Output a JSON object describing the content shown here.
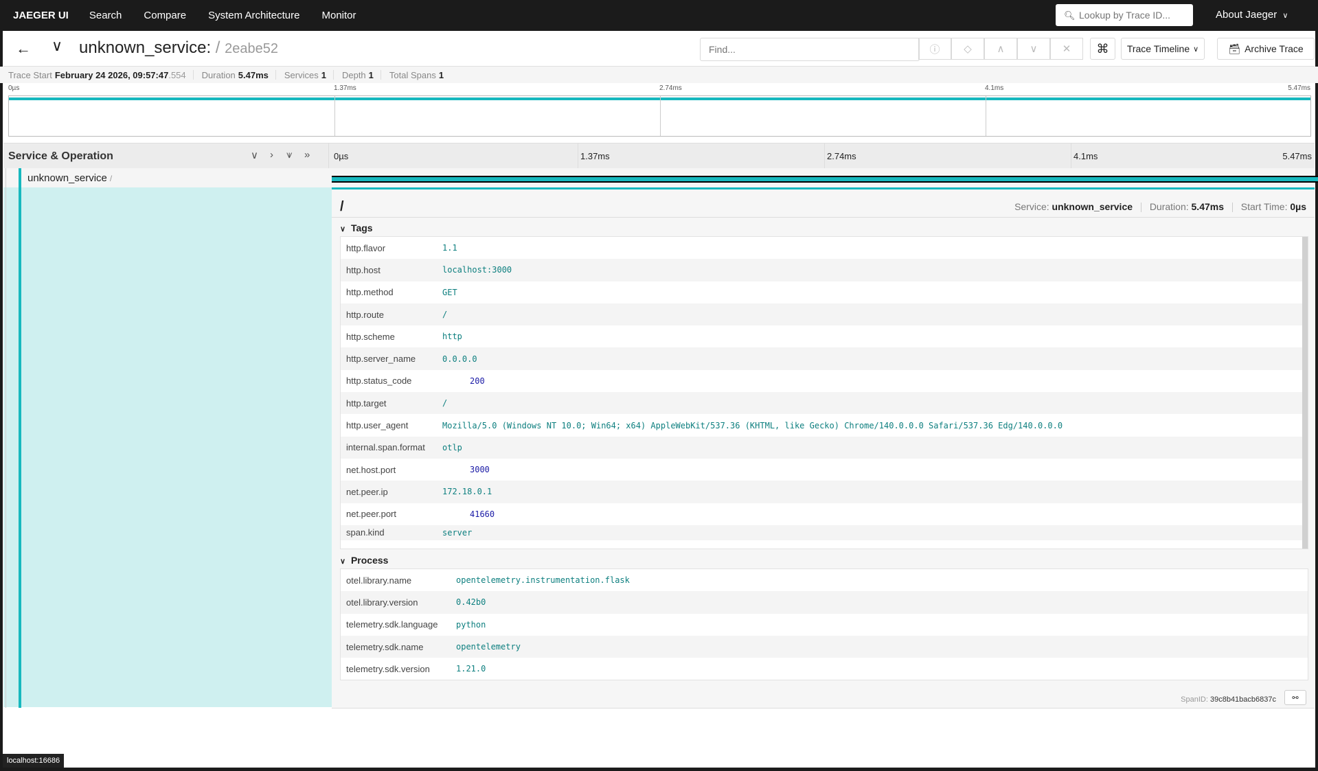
{
  "nav": {
    "brand": "JAEGER UI",
    "links": [
      "Search",
      "Compare",
      "System Architecture",
      "Monitor"
    ],
    "lookup_placeholder": "Lookup by Trace ID...",
    "about": "About Jaeger"
  },
  "header": {
    "service": "unknown_service:",
    "operation": "/",
    "trace_id": "2eabe52",
    "find_placeholder": "Find...",
    "view_mode": "Trace Timeline",
    "archive_label": "Archive Trace"
  },
  "meta": {
    "trace_start_label": "Trace Start",
    "trace_start": "February 24 2026, 09:57:47",
    "trace_start_ms": ".554",
    "duration_label": "Duration",
    "duration": "5.47ms",
    "services_label": "Services",
    "services": "1",
    "depth_label": "Depth",
    "depth": "1",
    "total_spans_label": "Total Spans",
    "total_spans": "1"
  },
  "minimap_ticks": [
    "0µs",
    "1.37ms",
    "2.74ms",
    "4.1ms",
    "5.47ms"
  ],
  "timeline": {
    "title": "Service & Operation",
    "ticks": [
      "0µs",
      "1.37ms",
      "2.74ms",
      "4.1ms",
      "5.47ms"
    ]
  },
  "span": {
    "service": "unknown_service",
    "operation": "/",
    "detail_title": "/",
    "service_label": "Service:",
    "service_value": "unknown_service",
    "duration_label": "Duration:",
    "duration_value": "5.47ms",
    "start_label": "Start Time:",
    "start_value": "0µs",
    "span_id_label": "SpanID:",
    "span_id": "39c8b41bacb6837c"
  },
  "tags_title": "Tags",
  "tags": [
    {
      "k": "http.flavor",
      "v": "1.1"
    },
    {
      "k": "http.host",
      "v": "localhost:3000"
    },
    {
      "k": "http.method",
      "v": "GET"
    },
    {
      "k": "http.route",
      "v": "/"
    },
    {
      "k": "http.scheme",
      "v": "http"
    },
    {
      "k": "http.server_name",
      "v": "0.0.0.0"
    },
    {
      "k": "http.status_code",
      "v": "200"
    },
    {
      "k": "http.target",
      "v": "/"
    },
    {
      "k": "http.user_agent",
      "v": "Mozilla/5.0 (Windows NT 10.0; Win64; x64) AppleWebKit/537.36 (KHTML, like Gecko) Chrome/140.0.0.0 Safari/537.36 Edg/140.0.0.0"
    },
    {
      "k": "internal.span.format",
      "v": "otlp"
    },
    {
      "k": "net.host.port",
      "v": "3000"
    },
    {
      "k": "net.peer.ip",
      "v": "172.18.0.1"
    },
    {
      "k": "net.peer.port",
      "v": "41660"
    },
    {
      "k": "span.kind",
      "v": "server"
    }
  ],
  "process_title": "Process",
  "process": [
    {
      "k": "otel.library.name",
      "v": "opentelemetry.instrumentation.flask"
    },
    {
      "k": "otel.library.version",
      "v": "0.42b0"
    },
    {
      "k": "telemetry.sdk.language",
      "v": "python"
    },
    {
      "k": "telemetry.sdk.name",
      "v": "opentelemetry"
    },
    {
      "k": "telemetry.sdk.version",
      "v": "1.21.0"
    }
  ],
  "status_url": "localhost:16686",
  "colors": {
    "accent": "#17b8be",
    "nav": "#1b1b1b",
    "span_fill": "#cff0f0"
  }
}
